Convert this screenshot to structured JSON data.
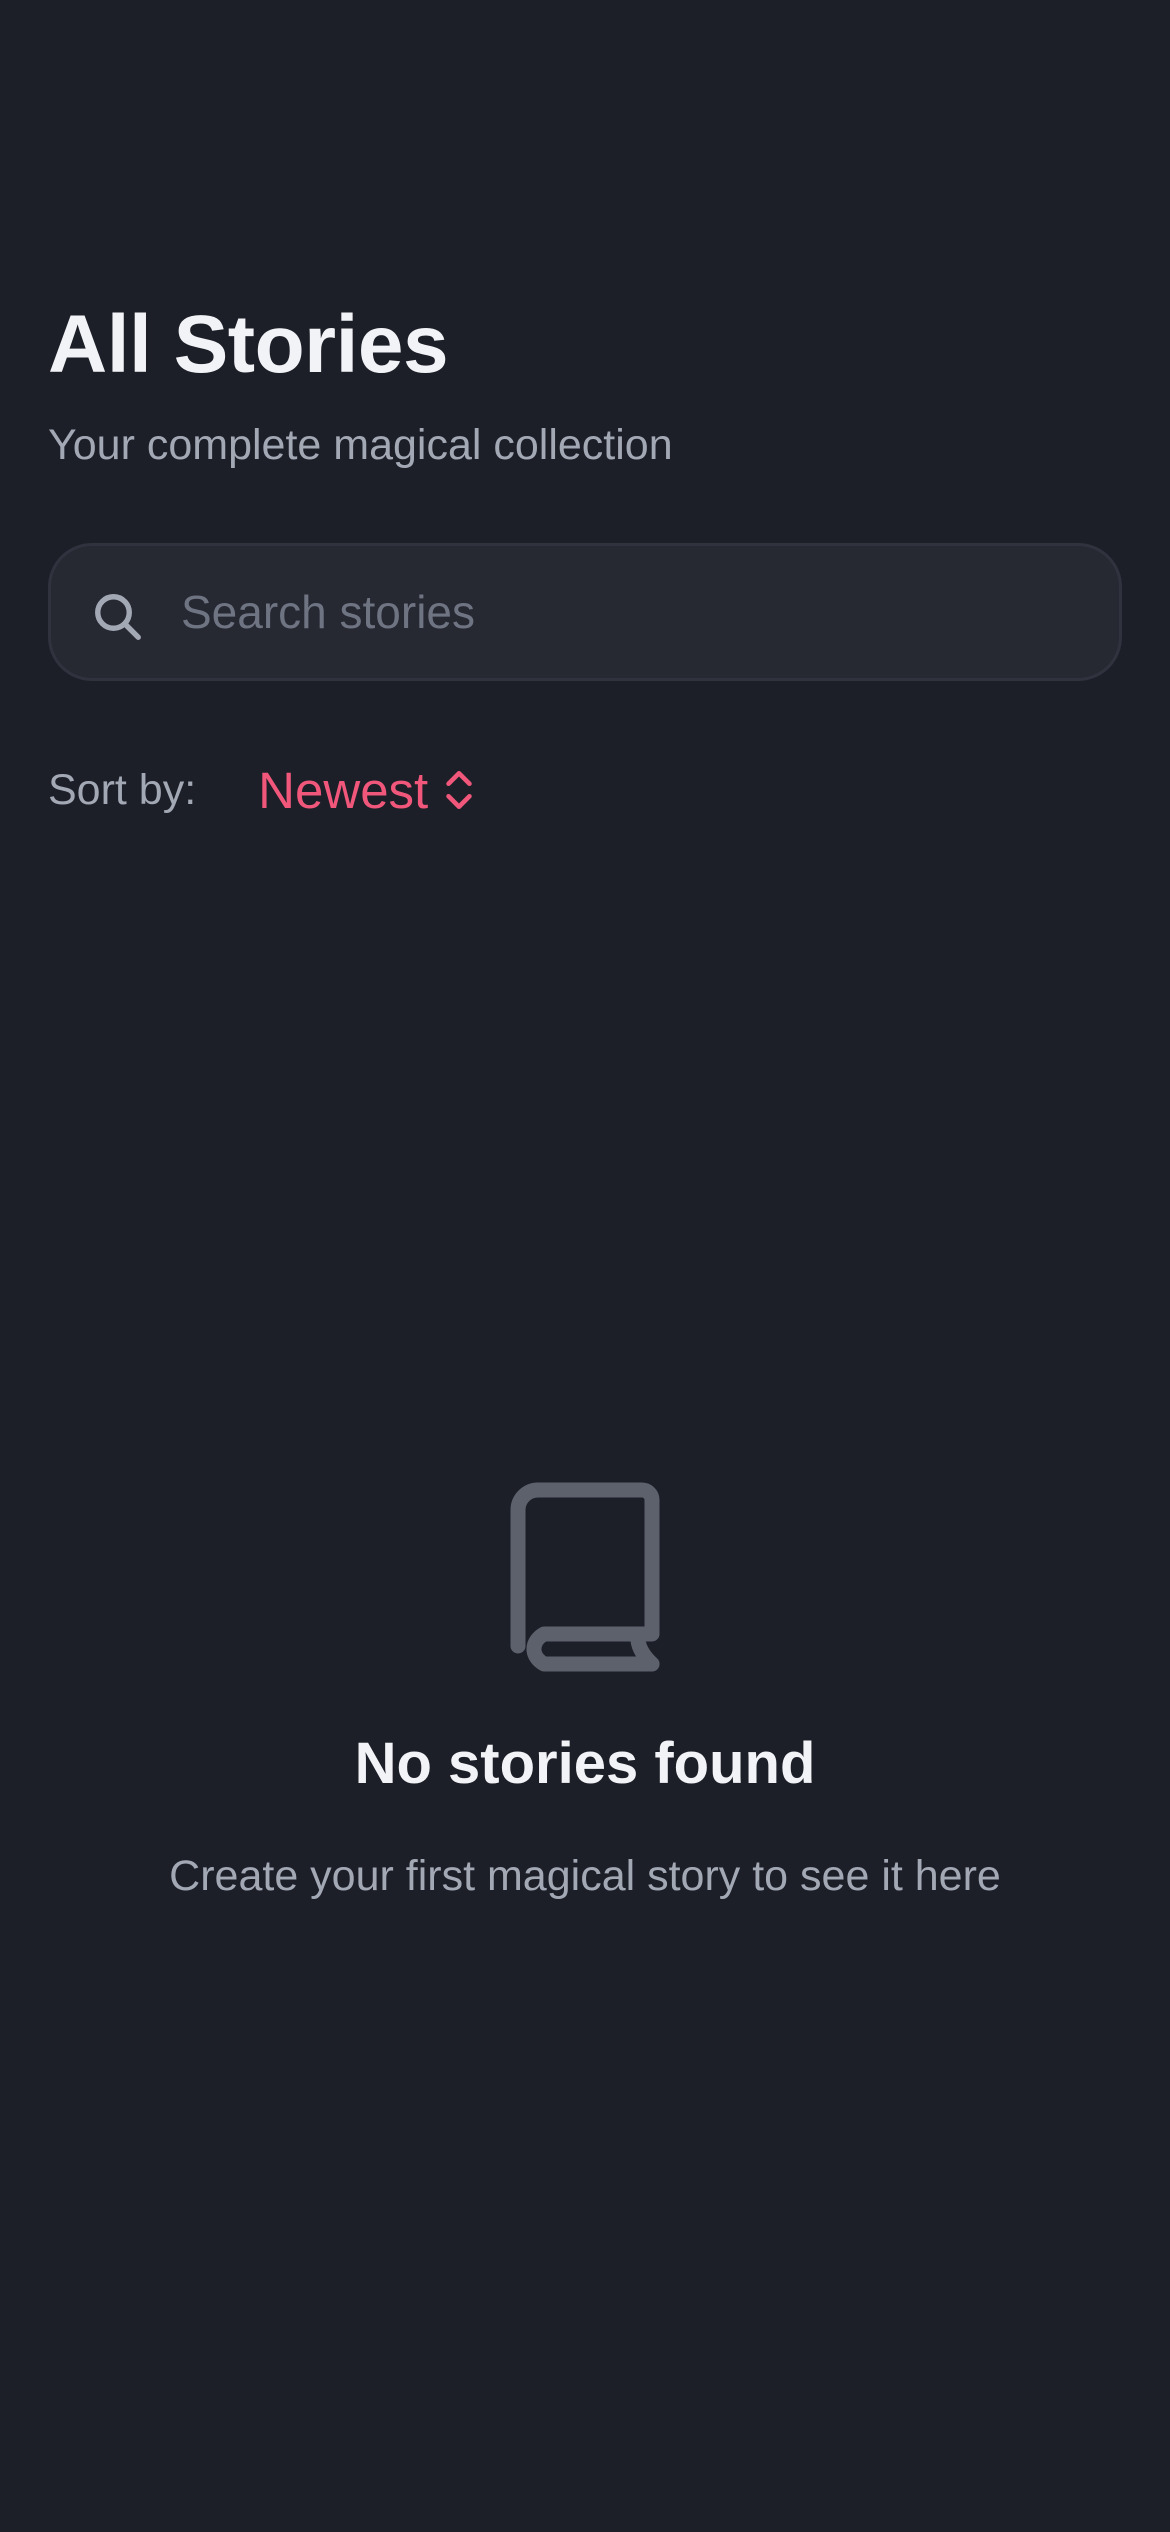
{
  "header": {
    "title": "All Stories",
    "subtitle": "Your complete magical collection"
  },
  "search": {
    "icon": "search-icon",
    "placeholder": "Search stories",
    "value": ""
  },
  "sort": {
    "label": "Sort by:",
    "selected": "Newest",
    "icon": "chevron-up-down-icon"
  },
  "empty_state": {
    "icon": "book-icon",
    "title": "No stories found",
    "description": "Create your first magical story to see it here"
  },
  "colors": {
    "background": "#1d1f28",
    "accent": "#f0577a",
    "text_primary": "#f2f3f7",
    "text_secondary": "#a3a8b5",
    "icon_muted": "#5d616c"
  }
}
